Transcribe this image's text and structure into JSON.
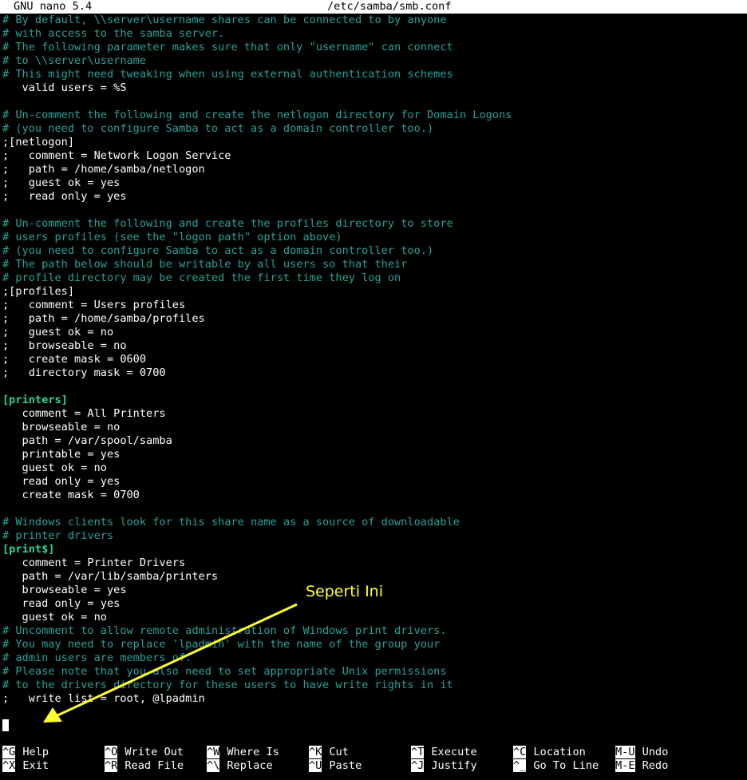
{
  "titlebar": {
    "app": "GNU nano 5.4",
    "file": "/etc/samba/smb.conf"
  },
  "lines": [
    {
      "t": "# By default, \\\\server\\username shares can be connected to by anyone",
      "k": "comment"
    },
    {
      "t": "# with access to the samba server.",
      "k": "comment"
    },
    {
      "t": "# The following parameter makes sure that only \"username\" can connect",
      "k": "comment"
    },
    {
      "t": "# to \\\\server\\username",
      "k": "comment"
    },
    {
      "t": "# This might need tweaking when using external authentication schemes",
      "k": "comment"
    },
    {
      "t": "   valid users = %S",
      "k": "default"
    },
    {
      "t": "",
      "k": "default"
    },
    {
      "t": "# Un-comment the following and create the netlogon directory for Domain Logons",
      "k": "comment"
    },
    {
      "t": "# (you need to configure Samba to act as a domain controller too.)",
      "k": "comment"
    },
    {
      "t": ";[netlogon]",
      "k": "default"
    },
    {
      "t": ";   comment = Network Logon Service",
      "k": "default"
    },
    {
      "t": ";   path = /home/samba/netlogon",
      "k": "default"
    },
    {
      "t": ";   guest ok = yes",
      "k": "default"
    },
    {
      "t": ";   read only = yes",
      "k": "default"
    },
    {
      "t": "",
      "k": "default"
    },
    {
      "t": "# Un-comment the following and create the profiles directory to store",
      "k": "comment"
    },
    {
      "t": "# users profiles (see the \"logon path\" option above)",
      "k": "comment"
    },
    {
      "t": "# (you need to configure Samba to act as a domain controller too.)",
      "k": "comment"
    },
    {
      "t": "# The path below should be writable by all users so that their",
      "k": "comment"
    },
    {
      "t": "# profile directory may be created the first time they log on",
      "k": "comment"
    },
    {
      "t": ";[profiles]",
      "k": "default"
    },
    {
      "t": ";   comment = Users profiles",
      "k": "default"
    },
    {
      "t": ";   path = /home/samba/profiles",
      "k": "default"
    },
    {
      "t": ";   guest ok = no",
      "k": "default"
    },
    {
      "t": ";   browseable = no",
      "k": "default"
    },
    {
      "t": ";   create mask = 0600",
      "k": "default"
    },
    {
      "t": ";   directory mask = 0700",
      "k": "default"
    },
    {
      "t": "",
      "k": "default"
    },
    {
      "t": "[printers]",
      "k": "section"
    },
    {
      "t": "   comment = All Printers",
      "k": "default"
    },
    {
      "t": "   browseable = no",
      "k": "default"
    },
    {
      "t": "   path = /var/spool/samba",
      "k": "default"
    },
    {
      "t": "   printable = yes",
      "k": "default"
    },
    {
      "t": "   guest ok = no",
      "k": "default"
    },
    {
      "t": "   read only = yes",
      "k": "default"
    },
    {
      "t": "   create mask = 0700",
      "k": "default"
    },
    {
      "t": "",
      "k": "default"
    },
    {
      "t": "# Windows clients look for this share name as a source of downloadable",
      "k": "comment"
    },
    {
      "t": "# printer drivers",
      "k": "comment"
    },
    {
      "t": "[print$]",
      "k": "section"
    },
    {
      "t": "   comment = Printer Drivers",
      "k": "default"
    },
    {
      "t": "   path = /var/lib/samba/printers",
      "k": "default"
    },
    {
      "t": "   browseable = yes",
      "k": "default"
    },
    {
      "t": "   read only = yes",
      "k": "default"
    },
    {
      "t": "   guest ok = no",
      "k": "default"
    },
    {
      "t": "# Uncomment to allow remote administration of Windows print drivers.",
      "k": "comment"
    },
    {
      "t": "# You may need to replace 'lpadmin' with the name of the group your",
      "k": "comment"
    },
    {
      "t": "# admin users are members of.",
      "k": "comment"
    },
    {
      "t": "# Please note that you also need to set appropriate Unix permissions",
      "k": "comment"
    },
    {
      "t": "# to the drivers directory for these users to have write rights in it",
      "k": "comment"
    },
    {
      "t": ";   write list = root, @lpadmin",
      "k": "default"
    }
  ],
  "shortcuts": [
    {
      "key": "^G",
      "label": "Help"
    },
    {
      "key": "^X",
      "label": "Exit"
    },
    {
      "key": "^O",
      "label": "Write Out"
    },
    {
      "key": "^R",
      "label": "Read File"
    },
    {
      "key": "^W",
      "label": "Where Is"
    },
    {
      "key": "^\\",
      "label": "Replace"
    },
    {
      "key": "^K",
      "label": "Cut"
    },
    {
      "key": "^U",
      "label": "Paste"
    },
    {
      "key": "^T",
      "label": "Execute"
    },
    {
      "key": "^J",
      "label": "Justify"
    },
    {
      "key": "^C",
      "label": "Location"
    },
    {
      "key": "^_",
      "label": "Go To Line"
    },
    {
      "key": "M-U",
      "label": "Undo"
    },
    {
      "key": "M-E",
      "label": "Redo"
    }
  ],
  "annotation": {
    "text": "Seperti Ini",
    "color": "#ffff33"
  },
  "colors": {
    "comment": "#2aa198",
    "section": "#2ed3a0",
    "background": "#000000",
    "text": "#ffffff"
  }
}
